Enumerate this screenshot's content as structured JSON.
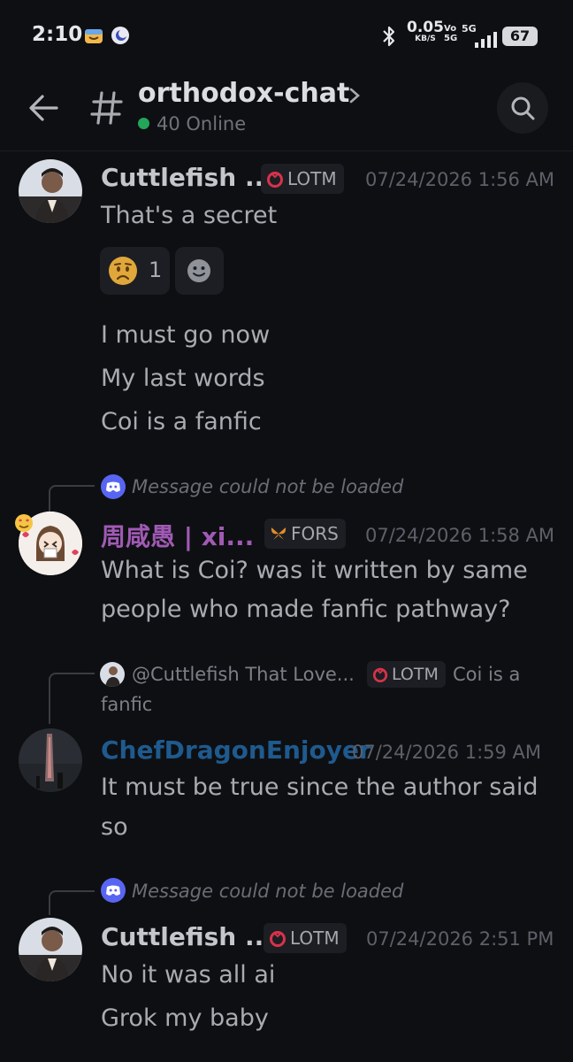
{
  "status_bar": {
    "time": "2:10",
    "net_speed": "0.05",
    "net_unit": "KB/S",
    "volte": "Vo 5G",
    "network": "5G",
    "battery": "67"
  },
  "header": {
    "channel": "orthodox-chat",
    "online": "40 Online"
  },
  "colors": {
    "online": "#23a55a",
    "user_xi": "#a05ab4",
    "user_chef": "#1e5a8e",
    "username_default": "#c4c6cb",
    "discord": "#5865f2"
  },
  "messages": [
    {
      "author": "Cuttlefish ...",
      "badge": "LOTM",
      "timestamp": "07/24/2026 1:56 AM",
      "lines": [
        "That's a secret"
      ],
      "reactions": [
        {
          "emoji": "worried-face",
          "count": "1"
        }
      ],
      "followups": [
        "I must go now",
        "My last words",
        "Coi is a fanfic"
      ]
    },
    {
      "reply": "Message could not be loaded",
      "author": "周咸愚 | xi...",
      "badge": "FORS",
      "timestamp": "07/24/2026 1:58 AM",
      "lines": [
        "What is Coi? was it written by same",
        "people who made fanfic pathway?"
      ]
    },
    {
      "reply_user": "@Cuttlefish That Love...",
      "reply_badge": "LOTM",
      "reply_snippet_a": "Coi is a",
      "reply_snippet_b": "fanfic",
      "author": "ChefDragonEnjoyer",
      "timestamp": "07/24/2026 1:59 AM",
      "lines": [
        "It must be true since the author said",
        "so"
      ]
    },
    {
      "reply": "Message could not be loaded",
      "author": "Cuttlefish ...",
      "badge": "LOTM",
      "timestamp": "07/24/2026 2:51 PM",
      "lines": [
        "No it was all ai",
        "Grok my baby"
      ]
    }
  ]
}
